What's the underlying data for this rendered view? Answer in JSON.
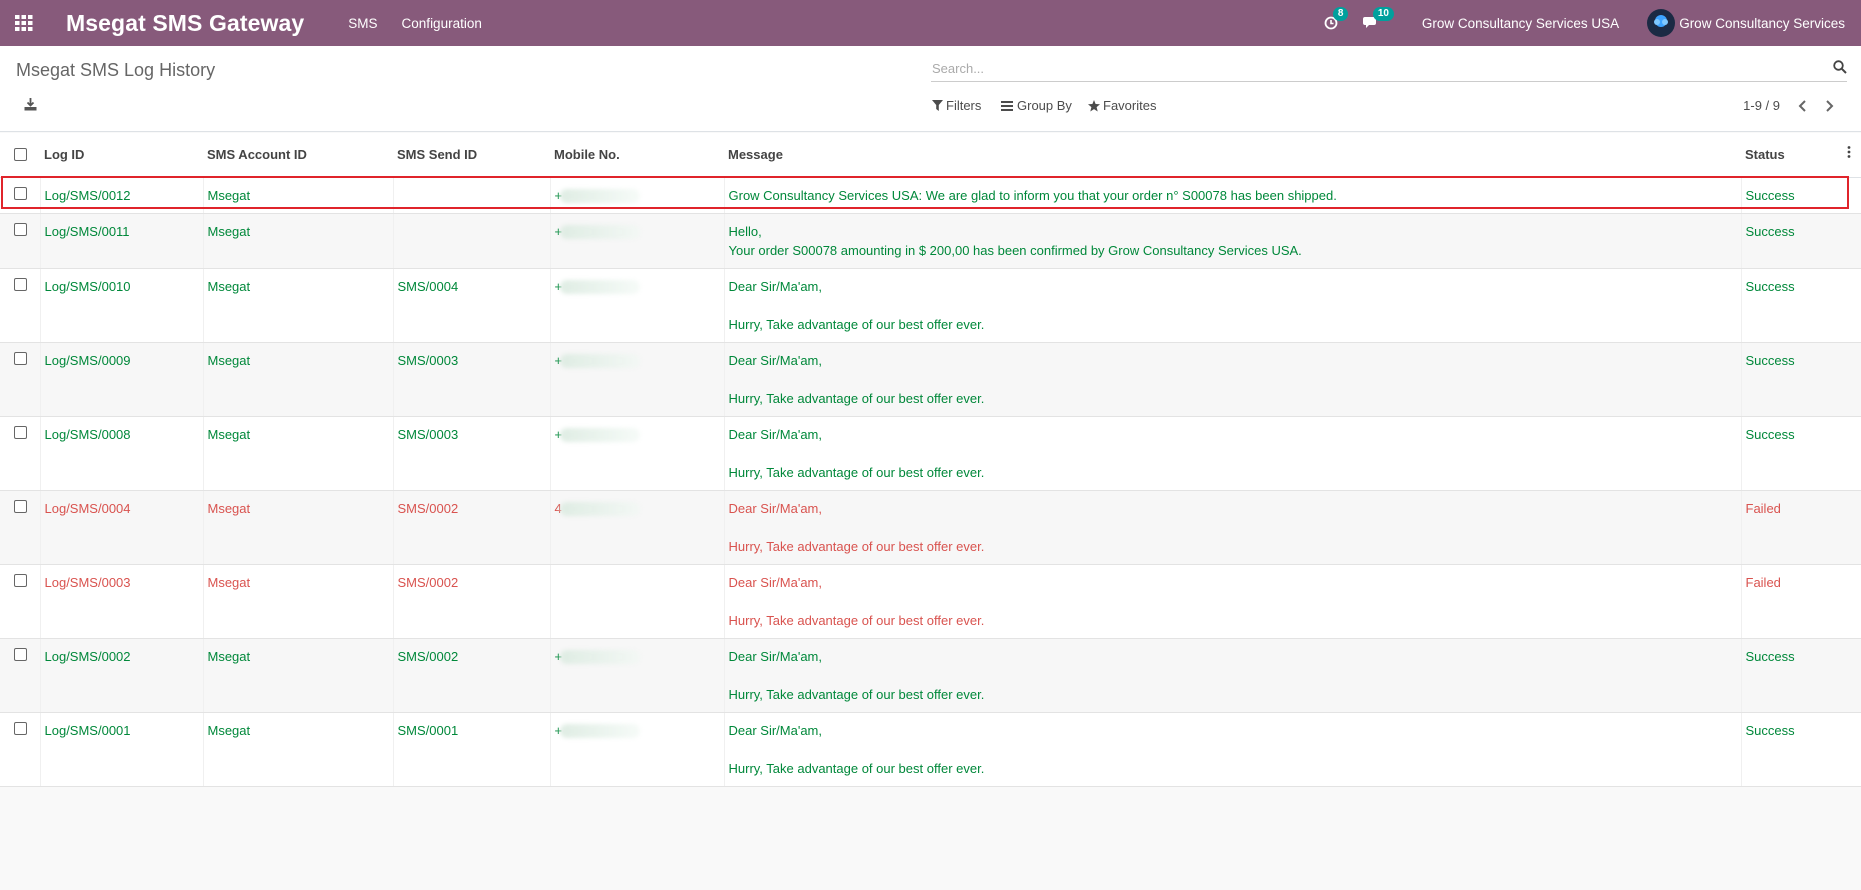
{
  "navbar": {
    "app_title": "Msegat SMS Gateway",
    "menus": [
      "SMS",
      "Configuration"
    ],
    "activity_count": "8",
    "messages_count": "10",
    "company_switch": "Grow Consultancy Services USA",
    "user_name": "Grow Consultancy Services",
    "bg_color": "#875a7b"
  },
  "control_panel": {
    "title": "Msegat SMS Log History",
    "search_placeholder": "Search...",
    "filters_label": "Filters",
    "group_by_label": "Group By",
    "favorites_label": "Favorites",
    "pager": "1-9 / 9"
  },
  "table": {
    "columns": [
      "Log ID",
      "SMS Account ID",
      "SMS Send ID",
      "Mobile No.",
      "Message",
      "Status"
    ],
    "rows": [
      {
        "log_id": "Log/SMS/0012",
        "account": "Msegat",
        "send_id": "",
        "mobile": "+",
        "message": "Grow Consultancy Services USA: We are glad to inform you that your order n° S00078 has been shipped.",
        "status": "Success",
        "state": "success"
      },
      {
        "log_id": "Log/SMS/0011",
        "account": "Msegat",
        "send_id": "",
        "mobile": "+",
        "message": "Hello,\nYour order S00078 amounting in $ 200,00 has been confirmed by Grow Consultancy Services USA.",
        "status": "Success",
        "state": "success"
      },
      {
        "log_id": "Log/SMS/0010",
        "account": "Msegat",
        "send_id": "SMS/0004",
        "mobile": "+",
        "message": "Dear Sir/Ma'am,\n\nHurry, Take advantage of our best offer ever.",
        "status": "Success",
        "state": "success"
      },
      {
        "log_id": "Log/SMS/0009",
        "account": "Msegat",
        "send_id": "SMS/0003",
        "mobile": "+",
        "message": "Dear Sir/Ma'am,\n\nHurry, Take advantage of our best offer ever.",
        "status": "Success",
        "state": "success"
      },
      {
        "log_id": "Log/SMS/0008",
        "account": "Msegat",
        "send_id": "SMS/0003",
        "mobile": "+",
        "message": "Dear Sir/Ma'am,\n\nHurry, Take advantage of our best offer ever.",
        "status": "Success",
        "state": "success"
      },
      {
        "log_id": "Log/SMS/0004",
        "account": "Msegat",
        "send_id": "SMS/0002",
        "mobile": "4",
        "message": "Dear Sir/Ma'am,\n\nHurry, Take advantage of our best offer ever.",
        "status": "Failed",
        "state": "failed"
      },
      {
        "log_id": "Log/SMS/0003",
        "account": "Msegat",
        "send_id": "SMS/0002",
        "mobile": "",
        "message": "Dear Sir/Ma'am,\n\nHurry, Take advantage of our best offer ever.",
        "status": "Failed",
        "state": "failed"
      },
      {
        "log_id": "Log/SMS/0002",
        "account": "Msegat",
        "send_id": "SMS/0002",
        "mobile": "+",
        "message": "Dear Sir/Ma'am,\n\nHurry, Take advantage of our best offer ever.",
        "status": "Success",
        "state": "success"
      },
      {
        "log_id": "Log/SMS/0001",
        "account": "Msegat",
        "send_id": "SMS/0001",
        "mobile": "+",
        "message": "Dear Sir/Ma'am,\n\nHurry, Take advantage of our best offer ever.",
        "status": "Success",
        "state": "success"
      }
    ]
  },
  "colors": {
    "success": "#00883a",
    "failed": "#d9534f",
    "highlight": "#e0242b",
    "badge": "#00a09d"
  }
}
